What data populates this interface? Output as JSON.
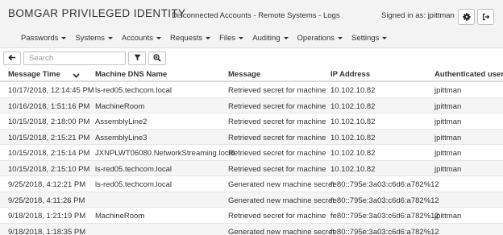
{
  "header": {
    "title": "BOMGAR PRIVILEGED IDENTITY",
    "breadcrumb": "Disconnected Accounts - Remote Systems - Logs",
    "signed_in": "Signed in as: jpittman",
    "settings_icon": "gear-icon",
    "logout_icon": "sign-out-icon"
  },
  "nav": {
    "items": [
      {
        "label": "Passwords"
      },
      {
        "label": "Systems"
      },
      {
        "label": "Accounts"
      },
      {
        "label": "Requests"
      },
      {
        "label": "Files"
      },
      {
        "label": "Auditing"
      },
      {
        "label": "Operations"
      },
      {
        "label": "Settings"
      }
    ]
  },
  "toolbar": {
    "back_icon": "arrow-left-icon",
    "search_placeholder": "Search",
    "search_value": "",
    "filter_icon": "filter-icon",
    "zoom_icon": "zoom-in-icon"
  },
  "table": {
    "columns": [
      "Message Time",
      "Machine DNS Name",
      "Message",
      "IP Address",
      "Authenticated user"
    ],
    "sort_icon": "chevron-down-icon",
    "rows": [
      [
        "10/17/2018, 12:14:45 PM",
        "ls-red05.techcom.local",
        "Retrieved secret for machine",
        "10.102.10.82",
        "jpittman"
      ],
      [
        "10/16/2018, 1:51:16 PM",
        "MachineRoom",
        "Retrieved secret for machine",
        "10.102.10.82",
        "jpittman"
      ],
      [
        "10/15/2018, 2:18:00 PM",
        "AssemblyLine2",
        "Retrieved secret for machine",
        "10.102.10.82",
        "jpittman"
      ],
      [
        "10/15/2018, 2:15:21 PM",
        "AssemblyLine3",
        "Retrieved secret for machine",
        "10.102.10.82",
        "jpittman"
      ],
      [
        "10/15/2018, 2:15:14 PM",
        "JXNPLWT06080.NetworkStreaming.local",
        "Retrieved secret for machine",
        "10.102.10.82",
        "jpittman"
      ],
      [
        "10/15/2018, 2:15:10 PM",
        "ls-red05.techcom.local",
        "Retrieved secret for machine",
        "10.102.10.82",
        "jpittman"
      ],
      [
        "9/25/2018, 4:12:21 PM",
        "ls-red05.techcom.local",
        "Generated new machine secret",
        "fe80::795e:3a03:c6d6:a782%12",
        ""
      ],
      [
        "9/25/2018, 4:11:26 PM",
        "",
        "Generated new machine secret",
        "fe80::795e:3a03:c6d6:a782%12",
        ""
      ],
      [
        "9/18/2018, 1:21:19 PM",
        "MachineRoom",
        "Retrieved secret for machine",
        "fe80::795e:3a03:c6d6:a782%12",
        "jpittman"
      ],
      [
        "9/18/2018, 1:18:35 PM",
        "",
        "Generated new machine secret",
        "fe80::795e:3a03:c6d6:a782%12",
        ""
      ]
    ]
  }
}
